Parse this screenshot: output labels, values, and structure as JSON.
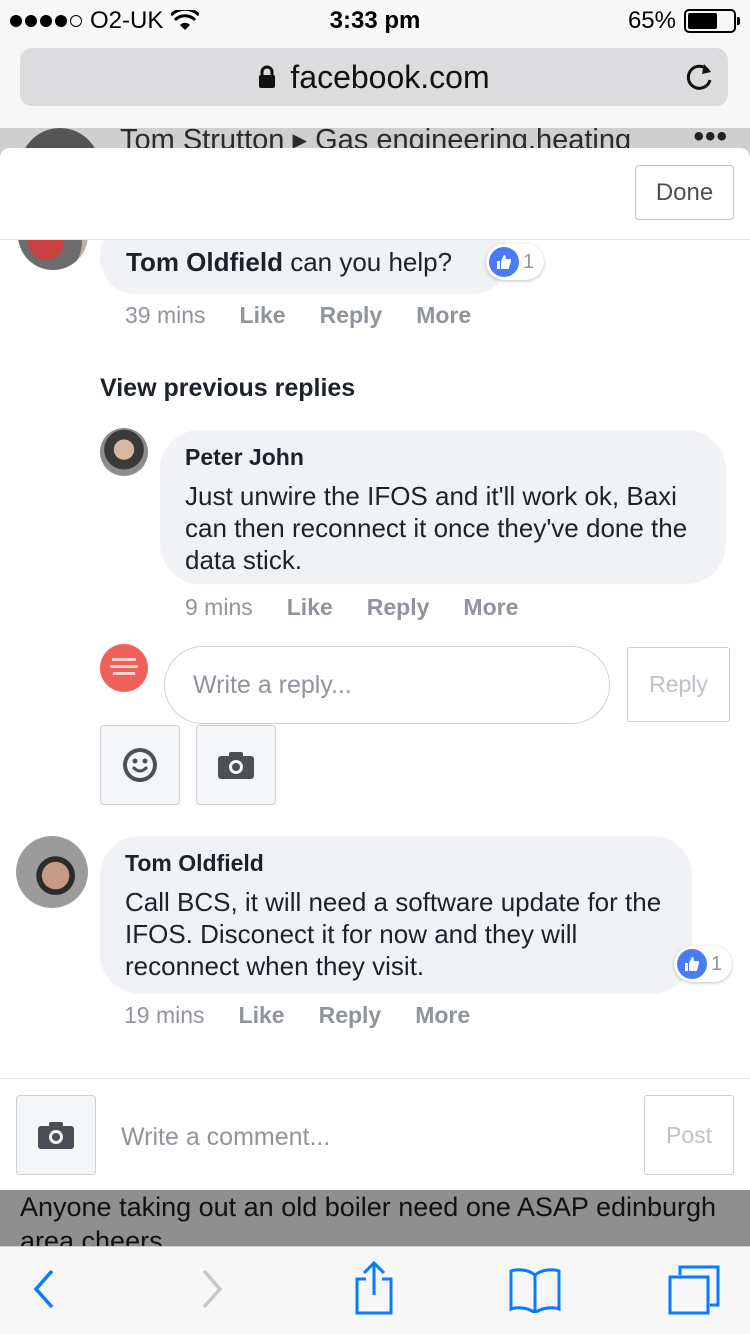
{
  "status_bar": {
    "carrier": "O2-UK",
    "time": "3:33 pm",
    "battery": "65%",
    "battery_level": 0.65
  },
  "browser": {
    "url": "facebook.com"
  },
  "background_post": {
    "header": "Tom Strutton ▸ Gas engineering,heating",
    "more": "•••",
    "text": "Anyone taking out an old boiler need one ASAP edinburgh area cheers"
  },
  "modal": {
    "done_label": "Done",
    "comments": [
      {
        "author": "Tom Oldfield",
        "text": "can you help?",
        "time": "39 mins",
        "like": "Like",
        "reply": "Reply",
        "more": "More",
        "reactions": "1"
      }
    ],
    "view_previous": "View previous replies",
    "replies": [
      {
        "author": "Peter John",
        "text": "Just unwire the IFOS and it'll work ok, Baxi can then reconnect it once they've done the data stick.",
        "time": "9 mins",
        "like": "Like",
        "reply": "Reply",
        "more": "More"
      }
    ],
    "reply_composer": {
      "placeholder": "Write a reply...",
      "button": "Reply"
    },
    "second_comment": {
      "author": "Tom Oldfield",
      "text": "Call BCS, it will need a software update for the IFOS. Disconect it for now and they will reconnect when they visit.",
      "time": "19 mins",
      "like": "Like",
      "reply": "Reply",
      "more": "More",
      "reactions": "1"
    },
    "comment_composer": {
      "placeholder": "Write a comment...",
      "button": "Post"
    }
  },
  "colors": {
    "accent": "#4a7bf7",
    "bubble": "#f1f2f6",
    "meta": "#90949c"
  }
}
